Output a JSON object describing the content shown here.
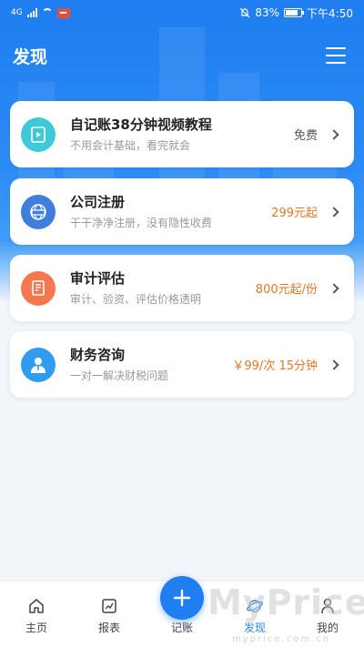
{
  "status_bar": {
    "network": "4G",
    "battery": "83%",
    "time": "下午4:50"
  },
  "header": {
    "title": "发现",
    "menu_icon": "hamburger-menu-icon"
  },
  "services": [
    {
      "title": "自记账38分钟视频教程",
      "subtitle": "不用会计基础，看完就会",
      "price": "免费",
      "icon": "video-tutorial-icon",
      "icon_color": "#3fc8d8",
      "price_color": "#555555"
    },
    {
      "title": "公司注册",
      "subtitle": "干干净净注册，没有隐性收费",
      "price": "299元起",
      "icon": "company-register-icon",
      "icon_color": "#3f7fdc",
      "price_color": "#e0782a"
    },
    {
      "title": "审计评估",
      "subtitle": "审计、验资、评估价格透明",
      "price": "800元起/份",
      "icon": "audit-document-icon",
      "icon_color": "#f5774f",
      "price_color": "#e0782a"
    },
    {
      "title": "财务咨询",
      "subtitle": "一对一解决财税问题",
      "price": "￥99/次 15分钟",
      "icon": "consultant-person-icon",
      "icon_color": "#2f9cf0",
      "price_color": "#e0782a"
    }
  ],
  "tabbar": {
    "home": "主页",
    "report": "报表",
    "bookkeeping": "记账",
    "discover": "发现",
    "mine": "我的",
    "active": "discover",
    "accent": "#2a86f0"
  },
  "watermark": {
    "brand": "MyPrice",
    "url": "myprice.com.cn"
  }
}
